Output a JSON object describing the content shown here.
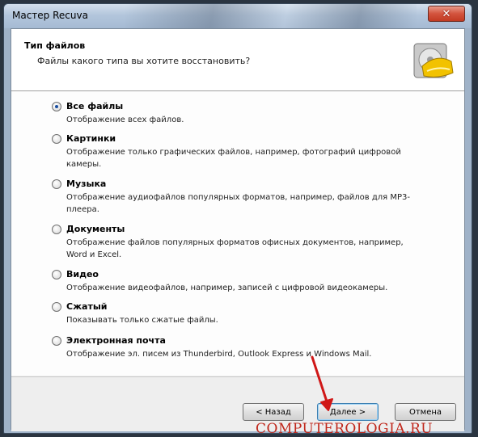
{
  "window": {
    "title": "Мастер Recuva",
    "close_glyph": "✕"
  },
  "header": {
    "title": "Тип файлов",
    "subtitle": "Файлы какого типа вы хотите восстановить?",
    "logo_icon": "recuva-helmet-drive-icon"
  },
  "options": [
    {
      "label": "Все файлы",
      "description": "Отображение всех файлов.",
      "selected": true
    },
    {
      "label": "Картинки",
      "description": "Отображение только графических файлов, например, фотографий цифровой камеры.",
      "selected": false
    },
    {
      "label": "Музыка",
      "description": "Отображение аудиофайлов популярных форматов, например, файлов для MP3-плеера.",
      "selected": false
    },
    {
      "label": "Документы",
      "description": "Отображение файлов популярных форматов офисных документов, например, Word и Excel.",
      "selected": false
    },
    {
      "label": "Видео",
      "description": "Отображение видеофайлов, например, записей с цифровой видеокамеры.",
      "selected": false
    },
    {
      "label": "Сжатый",
      "description": "Показывать только сжатые файлы.",
      "selected": false
    },
    {
      "label": "Электронная почта",
      "description": "Отображение эл. писем из Thunderbird, Outlook Express и Windows Mail.",
      "selected": false
    }
  ],
  "buttons": {
    "back": "< Назад",
    "next": "Далее >",
    "cancel": "Отмена"
  },
  "watermark": "COMPUTEROLOGIA.RU",
  "colors": {
    "accent": "#3c7fb1",
    "arrow": "#d01818",
    "watermark": "#c0281c",
    "close": "#c23a22"
  }
}
